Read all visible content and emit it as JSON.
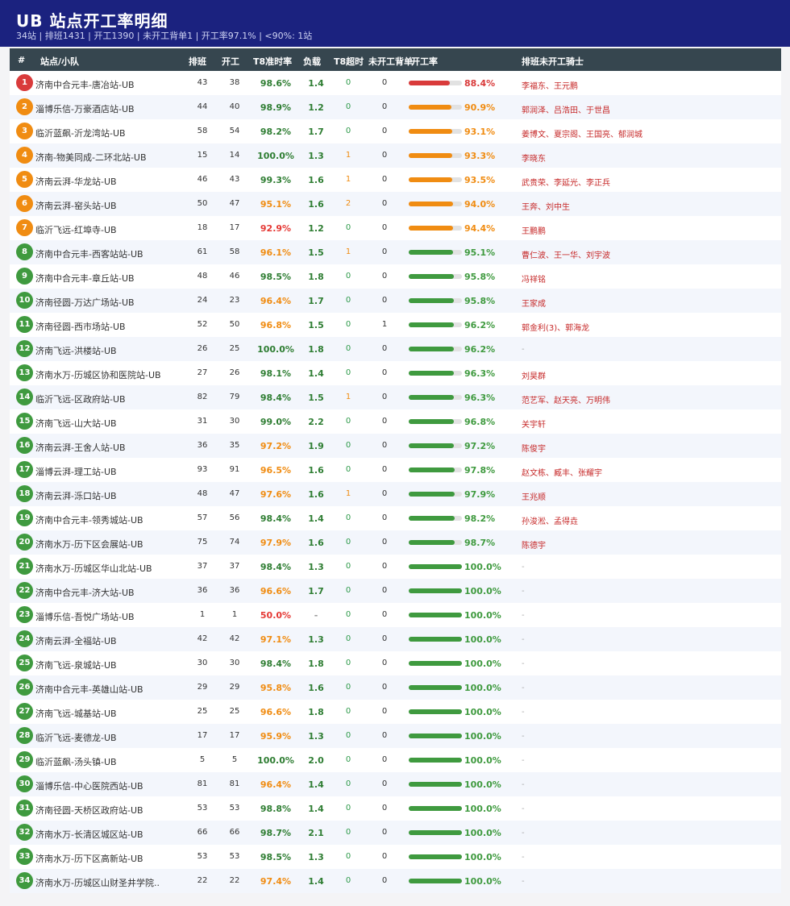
{
  "header": {
    "title": "UB 站点开工率明细",
    "subtitle": "34站 | 排班1431 | 开工1390 | 未开工背单1 | 开工率97.1% | <90%: 1站"
  },
  "columns": {
    "num": "#",
    "name": "站点/小队",
    "sched": "排班",
    "open": "开工",
    "t8": "T8准时率",
    "load": "负载",
    "t8o": "T8超时",
    "unopen": "未开工背单",
    "rate": "开工率",
    "riders": "排班未开工骑士"
  },
  "colors": {
    "red": "#d93b3b",
    "orange": "#f08c12",
    "green": "#3f9a3f",
    "t8_green": "#2e7d32",
    "t8_orange": "#f08c12",
    "t8_red": "#e53935",
    "t8o_orange": "#f08c12",
    "t8o_zero": "#2e9a4a"
  },
  "rows": [
    {
      "num": "1",
      "name": "济南中合元丰-唐冶站-UB",
      "sched": "43",
      "open": "38",
      "t8": "98.6%",
      "load": "1.4",
      "t8o": "0",
      "unopen": "0",
      "rate": "88.4%",
      "rate_value": 0.884,
      "riders": "李福东、王元鹏"
    },
    {
      "num": "2",
      "name": "淄博乐信-万豪酒店站-UB",
      "sched": "44",
      "open": "40",
      "t8": "98.9%",
      "load": "1.2",
      "t8o": "0",
      "unopen": "0",
      "rate": "90.9%",
      "rate_value": 0.909,
      "riders": "郭润泽、吕浩田、于世昌"
    },
    {
      "num": "3",
      "name": "临沂蓝飙-沂龙湾站-UB",
      "sched": "58",
      "open": "54",
      "t8": "98.2%",
      "load": "1.7",
      "t8o": "0",
      "unopen": "0",
      "rate": "93.1%",
      "rate_value": 0.931,
      "riders": "姜博文、夏宗阁、王国亮、郁润城"
    },
    {
      "num": "4",
      "name": "济南-物美同成-二环北站-UB",
      "sched": "15",
      "open": "14",
      "t8": "100.0%",
      "load": "1.3",
      "t8o": "1",
      "unopen": "0",
      "rate": "93.3%",
      "rate_value": 0.933,
      "riders": "李晓东"
    },
    {
      "num": "5",
      "name": "济南云湃-华龙站-UB",
      "sched": "46",
      "open": "43",
      "t8": "99.3%",
      "load": "1.6",
      "t8o": "1",
      "unopen": "0",
      "rate": "93.5%",
      "rate_value": 0.935,
      "riders": "武贵荣、李延光、李正兵"
    },
    {
      "num": "6",
      "name": "济南云湃-窑头站-UB",
      "sched": "50",
      "open": "47",
      "t8": "95.1%",
      "load": "1.6",
      "t8o": "2",
      "unopen": "0",
      "rate": "94.0%",
      "rate_value": 0.94,
      "riders": "王奔、刘中生"
    },
    {
      "num": "7",
      "name": "临沂飞远-红埠寺-UB",
      "sched": "18",
      "open": "17",
      "t8": "92.9%",
      "load": "1.2",
      "t8o": "0",
      "unopen": "0",
      "rate": "94.4%",
      "rate_value": 0.944,
      "riders": "王鹏鹏"
    },
    {
      "num": "8",
      "name": "济南中合元丰-西客站站-UB",
      "sched": "61",
      "open": "58",
      "t8": "96.1%",
      "load": "1.5",
      "t8o": "1",
      "unopen": "0",
      "rate": "95.1%",
      "rate_value": 0.951,
      "riders": "曹仁波、王一华、刘宇波"
    },
    {
      "num": "9",
      "name": "济南中合元丰-章丘站-UB",
      "sched": "48",
      "open": "46",
      "t8": "98.5%",
      "load": "1.8",
      "t8o": "0",
      "unopen": "0",
      "rate": "95.8%",
      "rate_value": 0.958,
      "riders": "冯祥铭"
    },
    {
      "num": "10",
      "name": "济南径圆-万达广场站-UB",
      "sched": "24",
      "open": "23",
      "t8": "96.4%",
      "load": "1.7",
      "t8o": "0",
      "unopen": "0",
      "rate": "95.8%",
      "rate_value": 0.958,
      "riders": "王家成"
    },
    {
      "num": "11",
      "name": "济南径圆-西市场站-UB",
      "sched": "52",
      "open": "50",
      "t8": "96.8%",
      "load": "1.5",
      "t8o": "0",
      "unopen": "1",
      "rate": "96.2%",
      "rate_value": 0.962,
      "riders": "郭金利(3)、郭海龙"
    },
    {
      "num": "12",
      "name": "济南飞远-洪楼站-UB",
      "sched": "26",
      "open": "25",
      "t8": "100.0%",
      "load": "1.8",
      "t8o": "0",
      "unopen": "0",
      "rate": "96.2%",
      "rate_value": 0.962,
      "riders": "-"
    },
    {
      "num": "13",
      "name": "济南水万-历城区协和医院站-UB",
      "sched": "27",
      "open": "26",
      "t8": "98.1%",
      "load": "1.4",
      "t8o": "0",
      "unopen": "0",
      "rate": "96.3%",
      "rate_value": 0.963,
      "riders": "刘昊群"
    },
    {
      "num": "14",
      "name": "临沂飞远-区政府站-UB",
      "sched": "82",
      "open": "79",
      "t8": "98.4%",
      "load": "1.5",
      "t8o": "1",
      "unopen": "0",
      "rate": "96.3%",
      "rate_value": 0.963,
      "riders": "范艺军、赵天亮、万明伟"
    },
    {
      "num": "15",
      "name": "济南飞远-山大站-UB",
      "sched": "31",
      "open": "30",
      "t8": "99.0%",
      "load": "2.2",
      "t8o": "0",
      "unopen": "0",
      "rate": "96.8%",
      "rate_value": 0.968,
      "riders": "关宇轩"
    },
    {
      "num": "16",
      "name": "济南云湃-王舍人站-UB",
      "sched": "36",
      "open": "35",
      "t8": "97.2%",
      "load": "1.9",
      "t8o": "0",
      "unopen": "0",
      "rate": "97.2%",
      "rate_value": 0.972,
      "riders": "陈俊宇"
    },
    {
      "num": "17",
      "name": "淄博云湃-理工站-UB",
      "sched": "93",
      "open": "91",
      "t8": "96.5%",
      "load": "1.6",
      "t8o": "0",
      "unopen": "0",
      "rate": "97.8%",
      "rate_value": 0.978,
      "riders": "赵文栋、臧丰、张耀宇"
    },
    {
      "num": "18",
      "name": "济南云湃-泺口站-UB",
      "sched": "48",
      "open": "47",
      "t8": "97.6%",
      "load": "1.6",
      "t8o": "1",
      "unopen": "0",
      "rate": "97.9%",
      "rate_value": 0.979,
      "riders": "王兆顺"
    },
    {
      "num": "19",
      "name": "济南中合元丰-领秀城站-UB",
      "sched": "57",
      "open": "56",
      "t8": "98.4%",
      "load": "1.4",
      "t8o": "0",
      "unopen": "0",
      "rate": "98.2%",
      "rate_value": 0.982,
      "riders": "孙浚淞、孟得垚"
    },
    {
      "num": "20",
      "name": "济南水万-历下区会展站-UB",
      "sched": "75",
      "open": "74",
      "t8": "97.9%",
      "load": "1.6",
      "t8o": "0",
      "unopen": "0",
      "rate": "98.7%",
      "rate_value": 0.987,
      "riders": "陈德宇"
    },
    {
      "num": "21",
      "name": "济南水万-历城区华山北站-UB",
      "sched": "37",
      "open": "37",
      "t8": "98.4%",
      "load": "1.3",
      "t8o": "0",
      "unopen": "0",
      "rate": "100.0%",
      "rate_value": 1.0,
      "riders": "-"
    },
    {
      "num": "22",
      "name": "济南中合元丰-济大站-UB",
      "sched": "36",
      "open": "36",
      "t8": "96.6%",
      "load": "1.7",
      "t8o": "0",
      "unopen": "0",
      "rate": "100.0%",
      "rate_value": 1.0,
      "riders": "-"
    },
    {
      "num": "23",
      "name": "淄博乐信-吾悦广场站-UB",
      "sched": "1",
      "open": "1",
      "t8": "50.0%",
      "load": "-",
      "t8o": "0",
      "unopen": "0",
      "rate": "100.0%",
      "rate_value": 1.0,
      "riders": "-"
    },
    {
      "num": "24",
      "name": "济南云湃-全福站-UB",
      "sched": "42",
      "open": "42",
      "t8": "97.1%",
      "load": "1.3",
      "t8o": "0",
      "unopen": "0",
      "rate": "100.0%",
      "rate_value": 1.0,
      "riders": "-"
    },
    {
      "num": "25",
      "name": "济南飞远-泉城站-UB",
      "sched": "30",
      "open": "30",
      "t8": "98.4%",
      "load": "1.8",
      "t8o": "0",
      "unopen": "0",
      "rate": "100.0%",
      "rate_value": 1.0,
      "riders": "-"
    },
    {
      "num": "26",
      "name": "济南中合元丰-英雄山站-UB",
      "sched": "29",
      "open": "29",
      "t8": "95.8%",
      "load": "1.6",
      "t8o": "0",
      "unopen": "0",
      "rate": "100.0%",
      "rate_value": 1.0,
      "riders": "-"
    },
    {
      "num": "27",
      "name": "济南飞远-城基站-UB",
      "sched": "25",
      "open": "25",
      "t8": "96.6%",
      "load": "1.8",
      "t8o": "0",
      "unopen": "0",
      "rate": "100.0%",
      "rate_value": 1.0,
      "riders": "-"
    },
    {
      "num": "28",
      "name": "临沂飞远-麦德龙-UB",
      "sched": "17",
      "open": "17",
      "t8": "95.9%",
      "load": "1.3",
      "t8o": "0",
      "unopen": "0",
      "rate": "100.0%",
      "rate_value": 1.0,
      "riders": "-"
    },
    {
      "num": "29",
      "name": "临沂蓝飙-汤头镇-UB",
      "sched": "5",
      "open": "5",
      "t8": "100.0%",
      "load": "2.0",
      "t8o": "0",
      "unopen": "0",
      "rate": "100.0%",
      "rate_value": 1.0,
      "riders": "-"
    },
    {
      "num": "30",
      "name": "淄博乐信-中心医院西站-UB",
      "sched": "81",
      "open": "81",
      "t8": "96.4%",
      "load": "1.4",
      "t8o": "0",
      "unopen": "0",
      "rate": "100.0%",
      "rate_value": 1.0,
      "riders": "-"
    },
    {
      "num": "31",
      "name": "济南径圆-天桥区政府站-UB",
      "sched": "53",
      "open": "53",
      "t8": "98.8%",
      "load": "1.4",
      "t8o": "0",
      "unopen": "0",
      "rate": "100.0%",
      "rate_value": 1.0,
      "riders": "-"
    },
    {
      "num": "32",
      "name": "济南水万-长清区城区站-UB",
      "sched": "66",
      "open": "66",
      "t8": "98.7%",
      "load": "2.1",
      "t8o": "0",
      "unopen": "0",
      "rate": "100.0%",
      "rate_value": 1.0,
      "riders": "-"
    },
    {
      "num": "33",
      "name": "济南水万-历下区高新站-UB",
      "sched": "53",
      "open": "53",
      "t8": "98.5%",
      "load": "1.3",
      "t8o": "0",
      "unopen": "0",
      "rate": "100.0%",
      "rate_value": 1.0,
      "riders": "-"
    },
    {
      "num": "34",
      "name": "济南水万-历城区山财圣井学院..",
      "sched": "22",
      "open": "22",
      "t8": "97.4%",
      "load": "1.4",
      "t8o": "0",
      "unopen": "0",
      "rate": "100.0%",
      "rate_value": 1.0,
      "riders": "-"
    }
  ]
}
